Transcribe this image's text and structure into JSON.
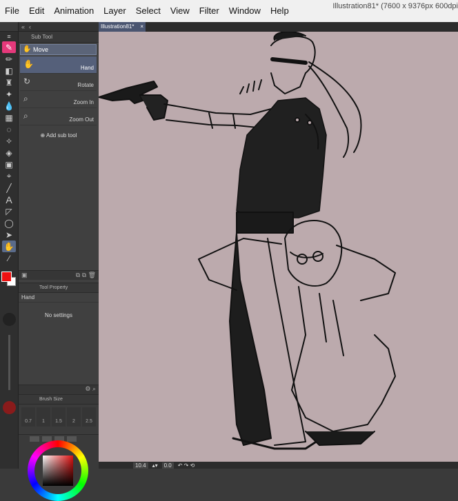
{
  "menu": [
    "File",
    "Edit",
    "Animation",
    "Layer",
    "Select",
    "View",
    "Filter",
    "Window",
    "Help"
  ],
  "window_title": "Illustration81* (7600 x 9376px 600dpi",
  "document_tab": {
    "label": "Illustration81*",
    "close": "×"
  },
  "subtool": {
    "panel_title": "Sub Tool",
    "group_label": "Move",
    "items": [
      {
        "label": "Hand",
        "icon": "hand-icon",
        "selected": true
      },
      {
        "label": "Rotate",
        "icon": "rotate-icon",
        "selected": false
      },
      {
        "label": "Zoom In",
        "icon": "zoom-in-icon",
        "selected": false
      },
      {
        "label": "Zoom Out",
        "icon": "zoom-out-icon",
        "selected": false
      }
    ],
    "add_label": "Add sub tool"
  },
  "tool_property": {
    "title": "Tool Property",
    "tool_name": "Hand",
    "empty_text": "No settings"
  },
  "brush_size": {
    "title": "Brush Size",
    "values": [
      "0.7",
      "1",
      "1.5",
      "2",
      "2.5"
    ]
  },
  "status": {
    "zoom": "10.4",
    "angle": "0.0"
  },
  "colors": {
    "foreground": "#ee1111",
    "background": "#ffffff",
    "canvas": "#bcaaad",
    "accent_tool": "#e6397b"
  }
}
